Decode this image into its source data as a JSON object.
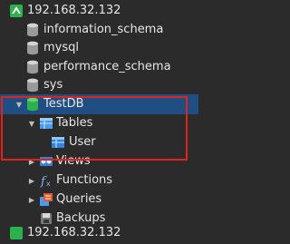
{
  "tree": {
    "connection": "192.168.32.132",
    "databases": [
      "information_schema",
      "mysql",
      "performance_schema",
      "sys"
    ],
    "open_db": "TestDB",
    "tables_label": "Tables",
    "table_user": "User",
    "views_label": "Views",
    "functions_label": "Functions",
    "queries_label": "Queries",
    "backups_label": "Backups",
    "next_connection": "192.168.32.132"
  },
  "colors": {
    "background": "#2b2b2b",
    "selected_row": "#1f4f82",
    "highlight_box": "#e0231d",
    "db_icon_gray": "#9a9a9a",
    "db_icon_green": "#2bb24c",
    "folder_blue": "#4a9be8"
  }
}
